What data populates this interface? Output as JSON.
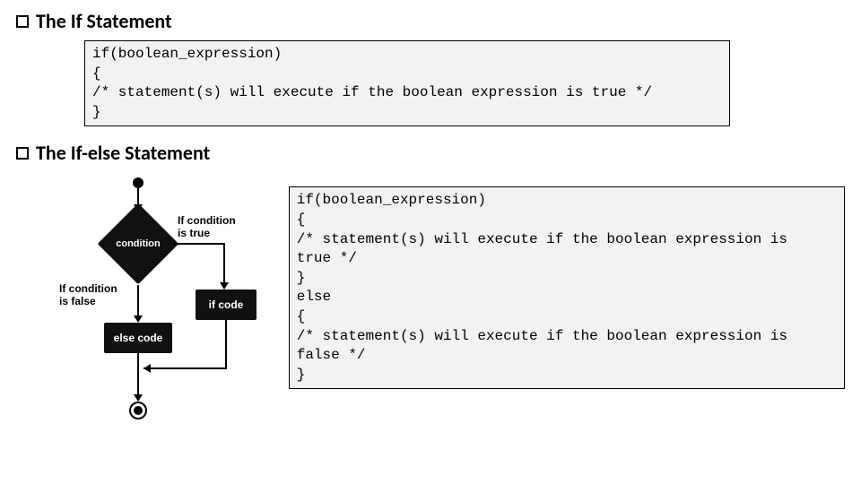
{
  "headings": {
    "if": "The If Statement",
    "ifelse": "The If-else Statement"
  },
  "code": {
    "if": "if(boolean_expression)\n{\n/* statement(s) will execute if the boolean expression is true */\n}",
    "ifelse": "if(boolean_expression)\n{\n/* statement(s) will execute if the boolean expression is\ntrue */\n}\nelse\n{\n/* statement(s) will execute if the boolean expression is\nfalse */\n}"
  },
  "flowchart": {
    "condition": "condition",
    "true_label": "If condition\nis true",
    "false_label": "If condition\nis false",
    "if_code": "if code",
    "else_code": "else code"
  }
}
